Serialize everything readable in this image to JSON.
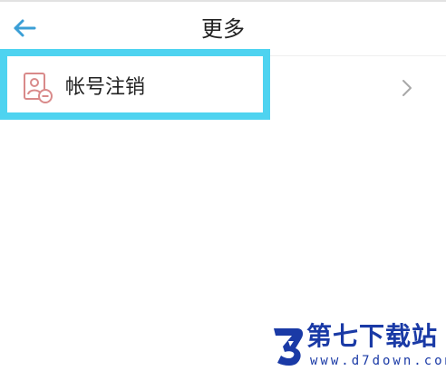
{
  "header": {
    "back_icon": "arrow-left-icon",
    "title": "更多",
    "accent_color": "#3b9fd6"
  },
  "menu": {
    "items": [
      {
        "label": "帐号注销",
        "icon": "account-cancel-icon",
        "trailing_icon": "chevron-right-icon"
      }
    ],
    "highlight_color": "#4ed3f0"
  },
  "watermark": {
    "name": "第七下载站",
    "url": "www.d7down.com",
    "color": "#1a3aa6"
  }
}
